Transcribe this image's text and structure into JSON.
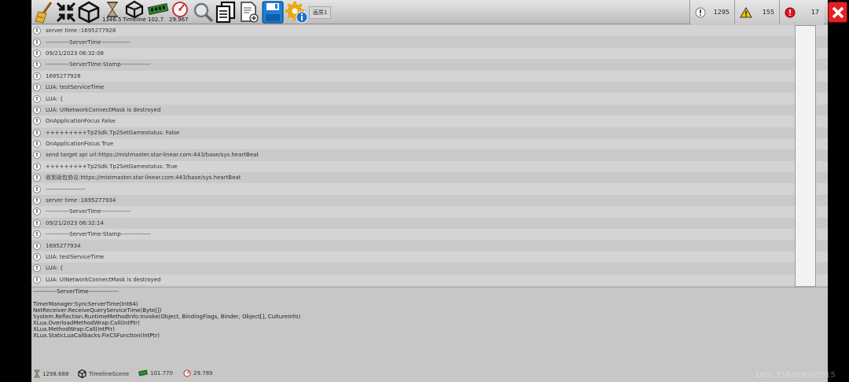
{
  "toolbar": {
    "time_value": "1346.5",
    "timeline_label": "Timeline",
    "memory_value": "102.7",
    "fps_value": "29.967",
    "tab_label": "画质1"
  },
  "counters": {
    "info_count": "1295",
    "warning_count": "155",
    "error_count": "17"
  },
  "logs": [
    "server time :1695277928",
    "------------ServerTime---------------",
    "09/21/2023 06:32:08",
    "------------ServerTime-Stamp---------------",
    "1695277928",
    "LUA: testServiceTime",
    "LUA: {",
    "LUA: UINetworkConnectMask is destroyed",
    "OnApplicationFocus False",
    "+++++++++Tp2Sdk.Tp2SetGamestatus: False",
    "OnApplicationFocus True",
    "send target api url:https://mistmaster.star-linear.com:443/base/sys.heartBeat",
    "+++++++++Tp2Sdk.Tp2SetGamestatus: True",
    "收到返包协议:https://mistmaster.star-linear.com:443/base/sys.heartBeat",
    "--------------------",
    "server time :1695277934",
    "------------ServerTime---------------",
    "09/21/2023 06:32:14",
    "------------ServerTime-Stamp---------------",
    "1695277934",
    "LUA: testServiceTime",
    "LUA: {",
    "LUA: UINetworkConnectMask is destroyed"
  ],
  "detail": {
    "title": "------------ServerTime---------------",
    "stack": [
      "TimerManager:SyncServerTime(Int64)",
      "NetReceiver:ReceiveQueryServiceTime(Byte[])",
      "System.Reflection.RuntimeMethodInfo:Invoke(Object, BindingFlags, Binder, Object[], CultureInfo)",
      "XLua.OverloadMethodWrap:Call(IntPtr)",
      "XLua.MethodWrap:Call(IntPtr)",
      "XLua.StaticLuaCallbacks:FixCSFunction(IntPtr)"
    ]
  },
  "footer": {
    "time_value": "1298.688",
    "scene_name": "TimelineScene",
    "memory_value": "101.770",
    "fps_value": "29.789"
  },
  "watermark": "UID: 316469107915",
  "icons": {
    "broom": "broom-icon",
    "collapse": "collapse-arrows-icon",
    "unity": "unity-logo-icon",
    "hourglass": "hourglass-icon",
    "memory": "memory-chip-icon",
    "gauge": "gauge-icon",
    "search": "magnifier-icon",
    "copy": "copy-icon",
    "add_doc": "add-document-icon",
    "save": "floppy-disk-icon",
    "settings": "gear-info-icon",
    "close": "close-icon"
  }
}
